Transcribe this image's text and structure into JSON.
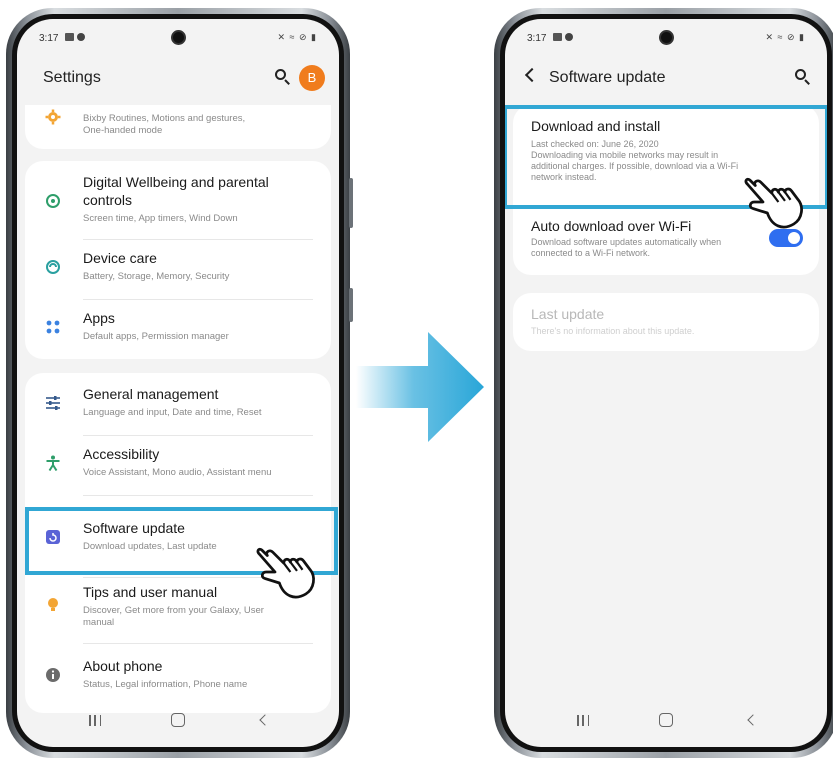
{
  "left_phone": {
    "status": {
      "time": "3:17",
      "right_icons": "✕ ≈ ⊘ ▮"
    },
    "header": {
      "title": "Settings",
      "avatar_letter": "B"
    },
    "top_partial": {
      "subtitle": "Bixby Routines, Motions and gestures,\nOne-handed mode"
    },
    "group1": [
      {
        "title": "Digital Wellbeing and parental\ncontrols",
        "subtitle": "Screen time, App timers, Wind Down"
      },
      {
        "title": "Device care",
        "subtitle": "Battery, Storage, Memory, Security"
      },
      {
        "title": "Apps",
        "subtitle": "Default apps, Permission manager"
      }
    ],
    "group2": [
      {
        "title": "General management",
        "subtitle": "Language and input, Date and time, Reset"
      },
      {
        "title": "Accessibility",
        "subtitle": "Voice Assistant, Mono audio, Assistant menu"
      },
      {
        "title": "Software update",
        "subtitle": "Download updates, Last update"
      },
      {
        "title": "Tips and user manual",
        "subtitle": "Discover, Get more from your Galaxy, User\nmanual"
      },
      {
        "title": "About phone",
        "subtitle": "Status, Legal information, Phone name"
      }
    ]
  },
  "right_phone": {
    "status": {
      "time": "3:17",
      "right_icons": "✕ ≈ ⊘ ▮"
    },
    "header": {
      "title": "Software update"
    },
    "download": {
      "title": "Download and install",
      "subtitle": "Last checked on: June 26, 2020\nDownloading via mobile networks may result in\nadditional charges. If possible, download via a Wi-Fi\nnetwork instead."
    },
    "auto": {
      "title": "Auto download over Wi-Fi",
      "subtitle": "Download software updates automatically when\nconnected to a Wi-Fi network.",
      "enabled": true
    },
    "last_update": {
      "title": "Last update",
      "subtitle": "There's no information about this update."
    }
  },
  "colors": {
    "highlight": "#31a7d4",
    "accent_green": "#2e9e6a",
    "accent_blue": "#2f6ef0",
    "avatar": "#f07c1d",
    "arrow": "#29a6d8"
  },
  "icons": {
    "routines": "gear-icon",
    "wellbeing": "wellbeing-icon",
    "device_care": "device-care-icon",
    "apps": "apps-grid-icon",
    "general": "sliders-icon",
    "accessibility": "accessibility-icon",
    "software_update": "software-update-icon",
    "tips": "lightbulb-icon",
    "about": "info-icon",
    "pointer": "hand-pointer-icon",
    "arrow": "right-arrow-icon"
  }
}
